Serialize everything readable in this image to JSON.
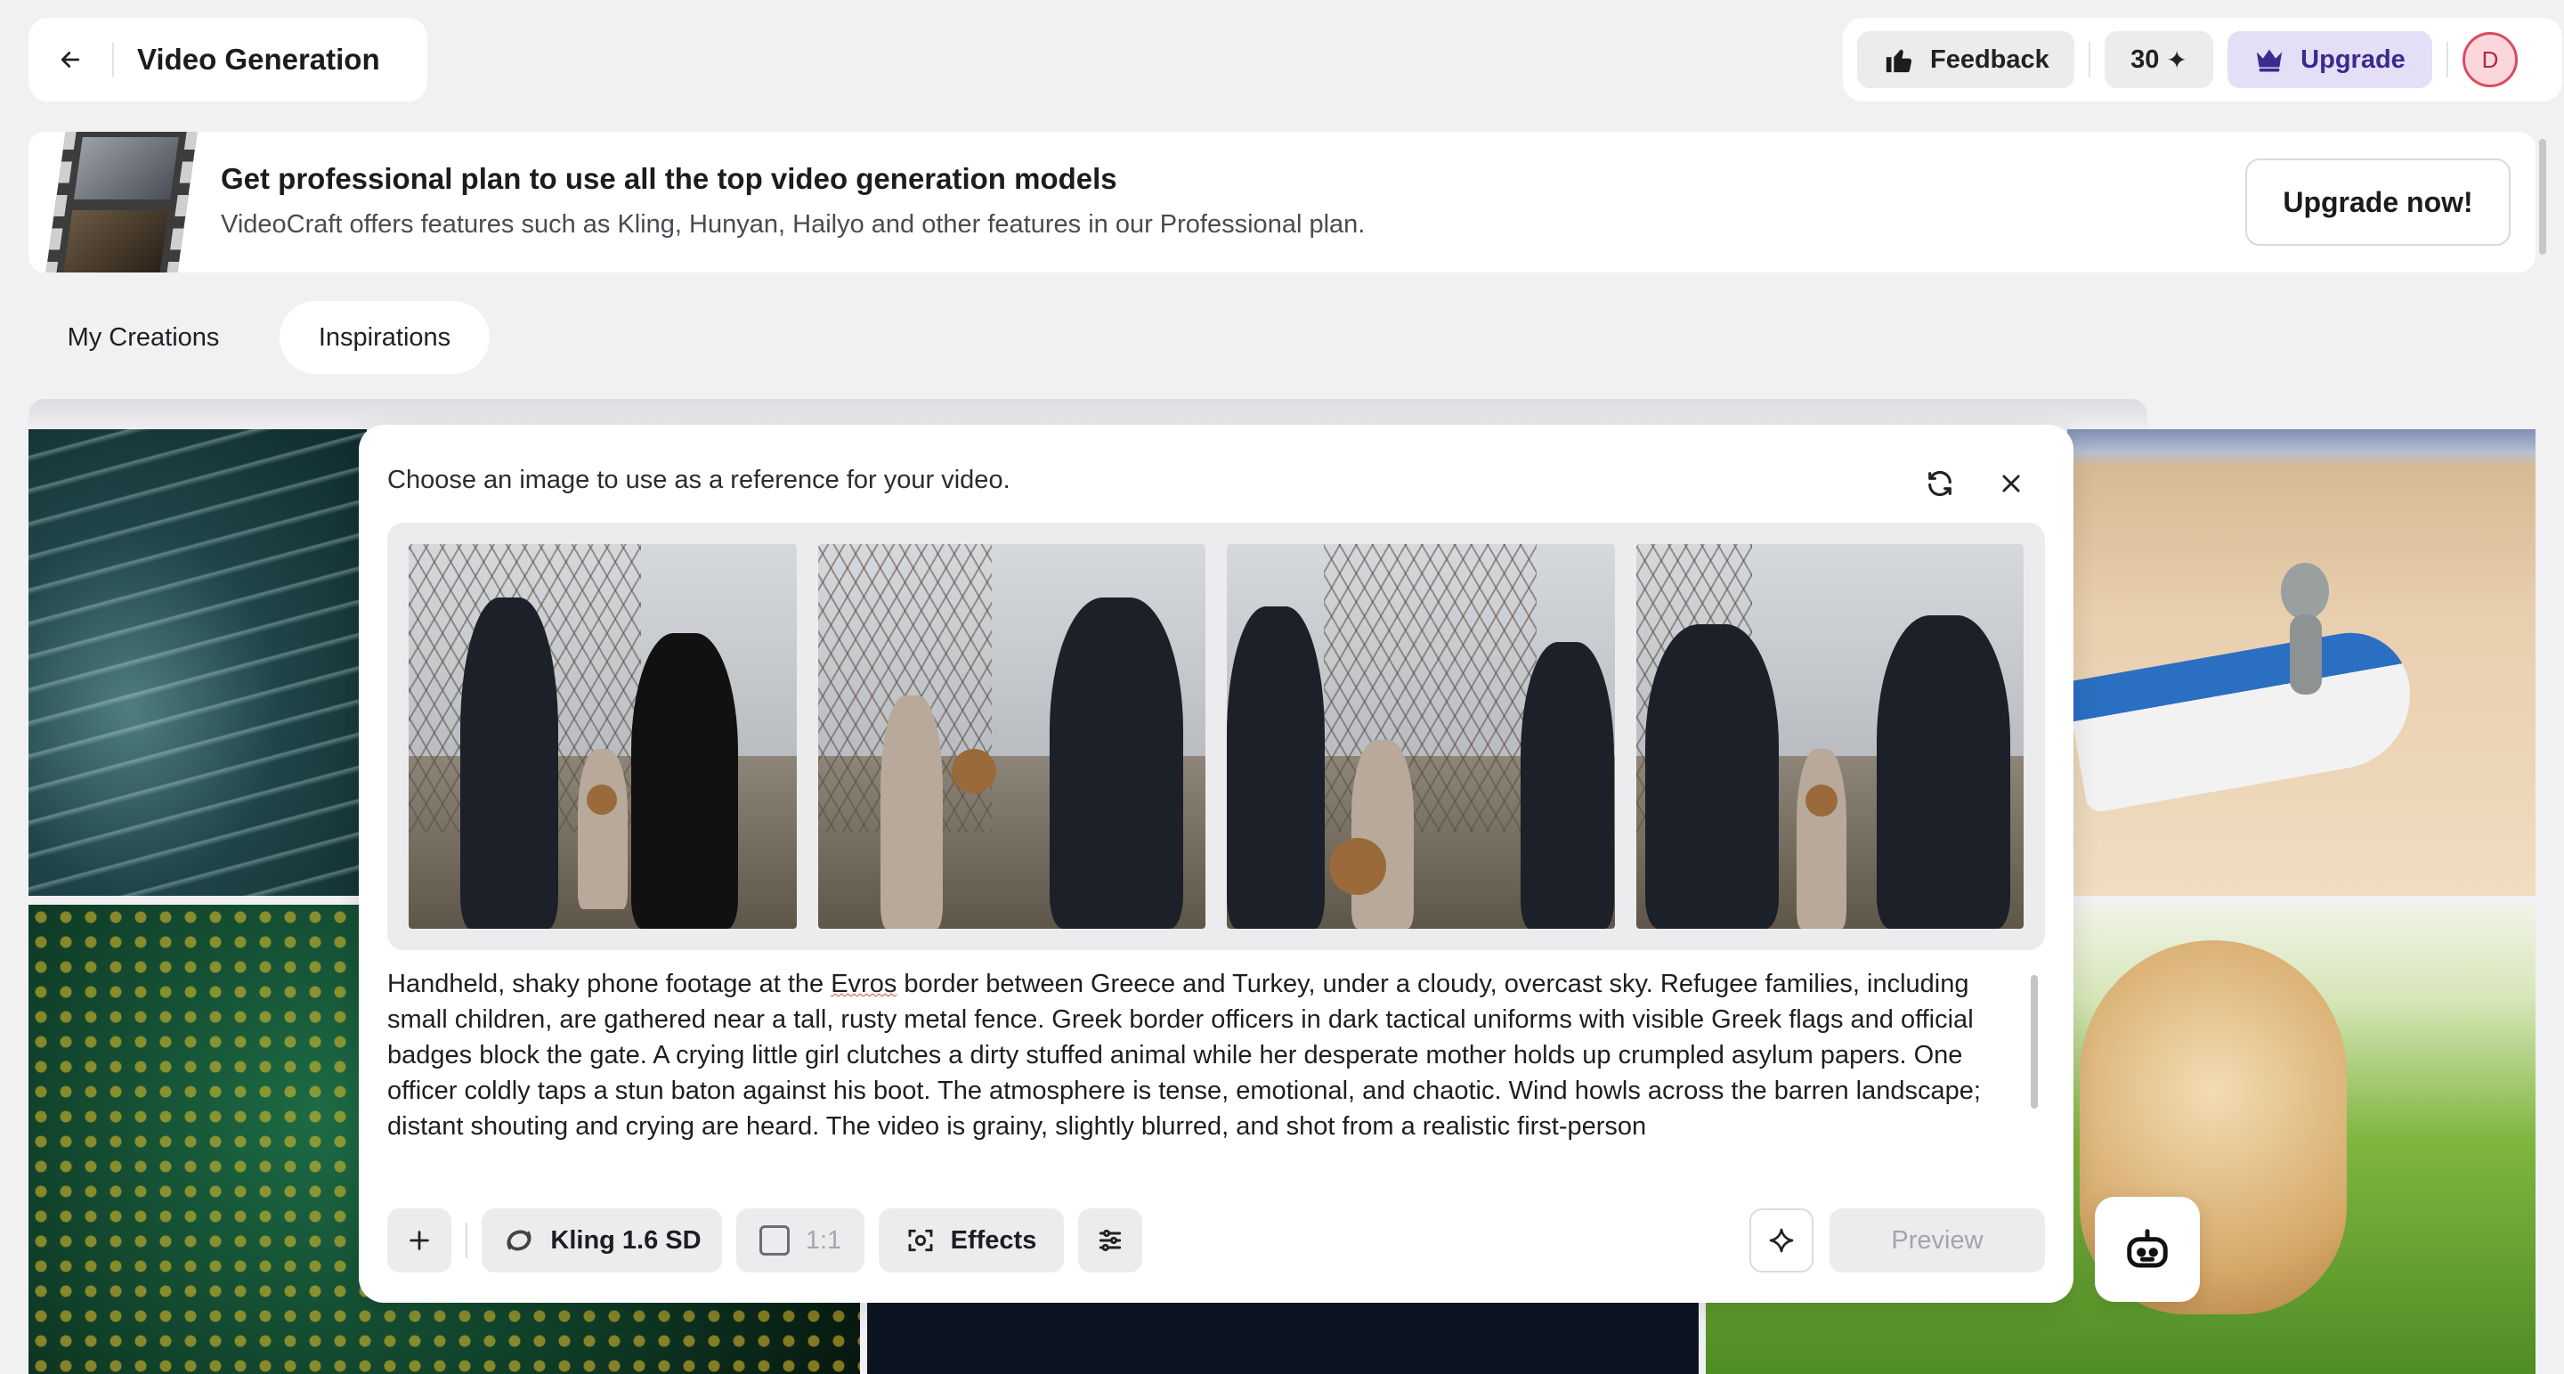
{
  "header": {
    "title": "Video Generation",
    "feedback_label": "Feedback",
    "credits": "30",
    "upgrade_label": "Upgrade",
    "avatar_initial": "D"
  },
  "promo": {
    "title": "Get professional plan to use all the top video generation models",
    "subtitle": "VideoCraft offers features such as Kling, Hunyan, Hailyo and other features in our Professional plan.",
    "button_label": "Upgrade now!"
  },
  "tabs": [
    {
      "label": "My Creations",
      "active": false
    },
    {
      "label": "Inspirations",
      "active": true
    }
  ],
  "modal": {
    "title": "Choose an image to use as a reference for your video.",
    "prompt_before": "Handheld, shaky phone footage at the ",
    "prompt_flagged": "Evros",
    "prompt_after": " border between Greece and Turkey, under a cloudy, overcast sky. Refugee families, including small children, are gathered near a tall, rusty metal fence. Greek border officers in dark tactical uniforms with visible Greek flags and official badges block the gate. A crying little girl clutches a dirty stuffed animal while her desperate mother holds up crumpled asylum papers. One officer coldly taps a stun baton against his boot. The atmosphere is tense, emotional, and chaotic. Wind howls across the barren landscape; distant shouting and crying are heard. The video is grainy, slightly blurred, and shot from a realistic first-person"
  },
  "toolbar": {
    "model_label": "Kling 1.6 SD",
    "ratio_label": "1:1",
    "effects_label": "Effects",
    "preview_label": "Preview"
  },
  "colors": {
    "accent": "#3b2a8f",
    "upgrade_bg": "#e4dff6",
    "avatar_border": "#d84c5f",
    "page_bg": "#f1f1f3"
  }
}
